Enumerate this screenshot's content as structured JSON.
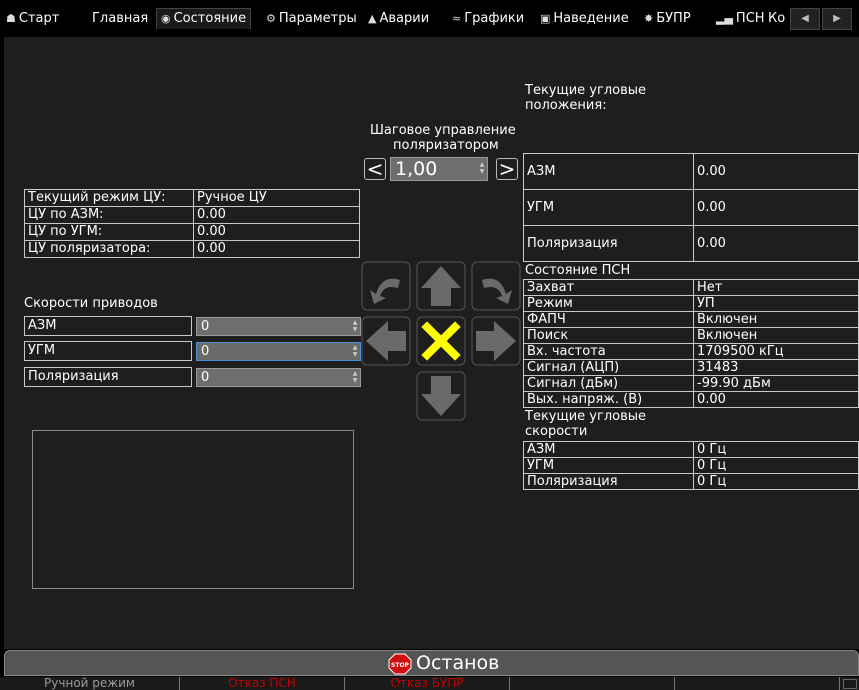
{
  "tabs": [
    {
      "label": "Старт",
      "icon": "home-icon",
      "glyph": "☗"
    },
    {
      "label": "Главная",
      "icon": "",
      "glyph": ""
    },
    {
      "label": "Состояние",
      "icon": "eye-icon",
      "glyph": "◉"
    },
    {
      "label": "Параметры",
      "icon": "gears-icon",
      "glyph": "⚙"
    },
    {
      "label": "Аварии",
      "icon": "warning-icon",
      "glyph": "▲"
    },
    {
      "label": "Графики",
      "icon": "chart-icon",
      "glyph": "≈"
    },
    {
      "label": "Наведение",
      "icon": "target-icon",
      "glyph": "▣"
    },
    {
      "label": "БУПР",
      "icon": "satellite-icon",
      "glyph": "✸"
    },
    {
      "label": "ПСН",
      "icon": "signal-icon",
      "glyph": "▂▄"
    },
    {
      "label": "Ко",
      "icon": "",
      "glyph": ""
    }
  ],
  "active_tab": "Состояние",
  "step_control": {
    "title_line1": "Шаговое управление",
    "title_line2": "поляризатором",
    "left_btn": "<",
    "right_btn": ">",
    "value": "1,00"
  },
  "cu_table": [
    {
      "label": "Текущий режим ЦУ:",
      "value": "Ручное ЦУ"
    },
    {
      "label": "ЦУ по АЗМ:",
      "value": "0.00"
    },
    {
      "label": "ЦУ по УГМ:",
      "value": "0.00"
    },
    {
      "label": "ЦУ поляризатора:",
      "value": "0.00"
    }
  ],
  "drive_speeds": {
    "title": "Скорости приводов",
    "rows": [
      {
        "label": "АЗМ",
        "value": "0"
      },
      {
        "label": "УГМ",
        "value": "0"
      },
      {
        "label": "Поляризация",
        "value": "0"
      }
    ]
  },
  "angular_positions": {
    "title_line1": "Текущие угловые",
    "title_line2": "положения:",
    "rows": [
      {
        "label": "АЗМ",
        "value": "0.00"
      },
      {
        "label": "УГМ",
        "value": "0.00"
      },
      {
        "label": "Поляризация",
        "value": "0.00"
      }
    ]
  },
  "psn_state": {
    "title": "Состояние ПСН",
    "rows": [
      {
        "label": "Захват",
        "value": "Нет"
      },
      {
        "label": "Режим",
        "value": "УП"
      },
      {
        "label": "ФАПЧ",
        "value": "Включен"
      },
      {
        "label": "Поиск",
        "value": "Включен"
      },
      {
        "label": "Вх. частота",
        "value": "1709500 кГц"
      },
      {
        "label": "Сигнал (АЦП)",
        "value": "31483"
      },
      {
        "label": "Сигнал (дБм)",
        "value": "-99.90 дБм"
      },
      {
        "label": "Вых. напряж. (В)",
        "value": "0.00"
      }
    ]
  },
  "angular_speeds": {
    "title_line1": "Текущие угловые",
    "title_line2": "скорости",
    "rows": [
      {
        "label": "АЗМ",
        "value": "0 Гц"
      },
      {
        "label": "УГМ",
        "value": "0 Гц"
      },
      {
        "label": "Поляризация",
        "value": "0 Гц"
      }
    ]
  },
  "stop_button": {
    "label": "Останов",
    "icon_text": "STOP"
  },
  "status_bar": [
    {
      "label": "Ручной режим",
      "color": "#9a9a9a"
    },
    {
      "label": "Отказ ПСН",
      "color": "#c00000"
    },
    {
      "label": "Отказ БУПР",
      "color": "#c00000"
    },
    {
      "label": "",
      "color": "#9a9a9a"
    },
    {
      "label": "",
      "color": "#9a9a9a"
    }
  ],
  "colors": {
    "accent_x": "#ffff00",
    "stop_red": "#d01010"
  }
}
